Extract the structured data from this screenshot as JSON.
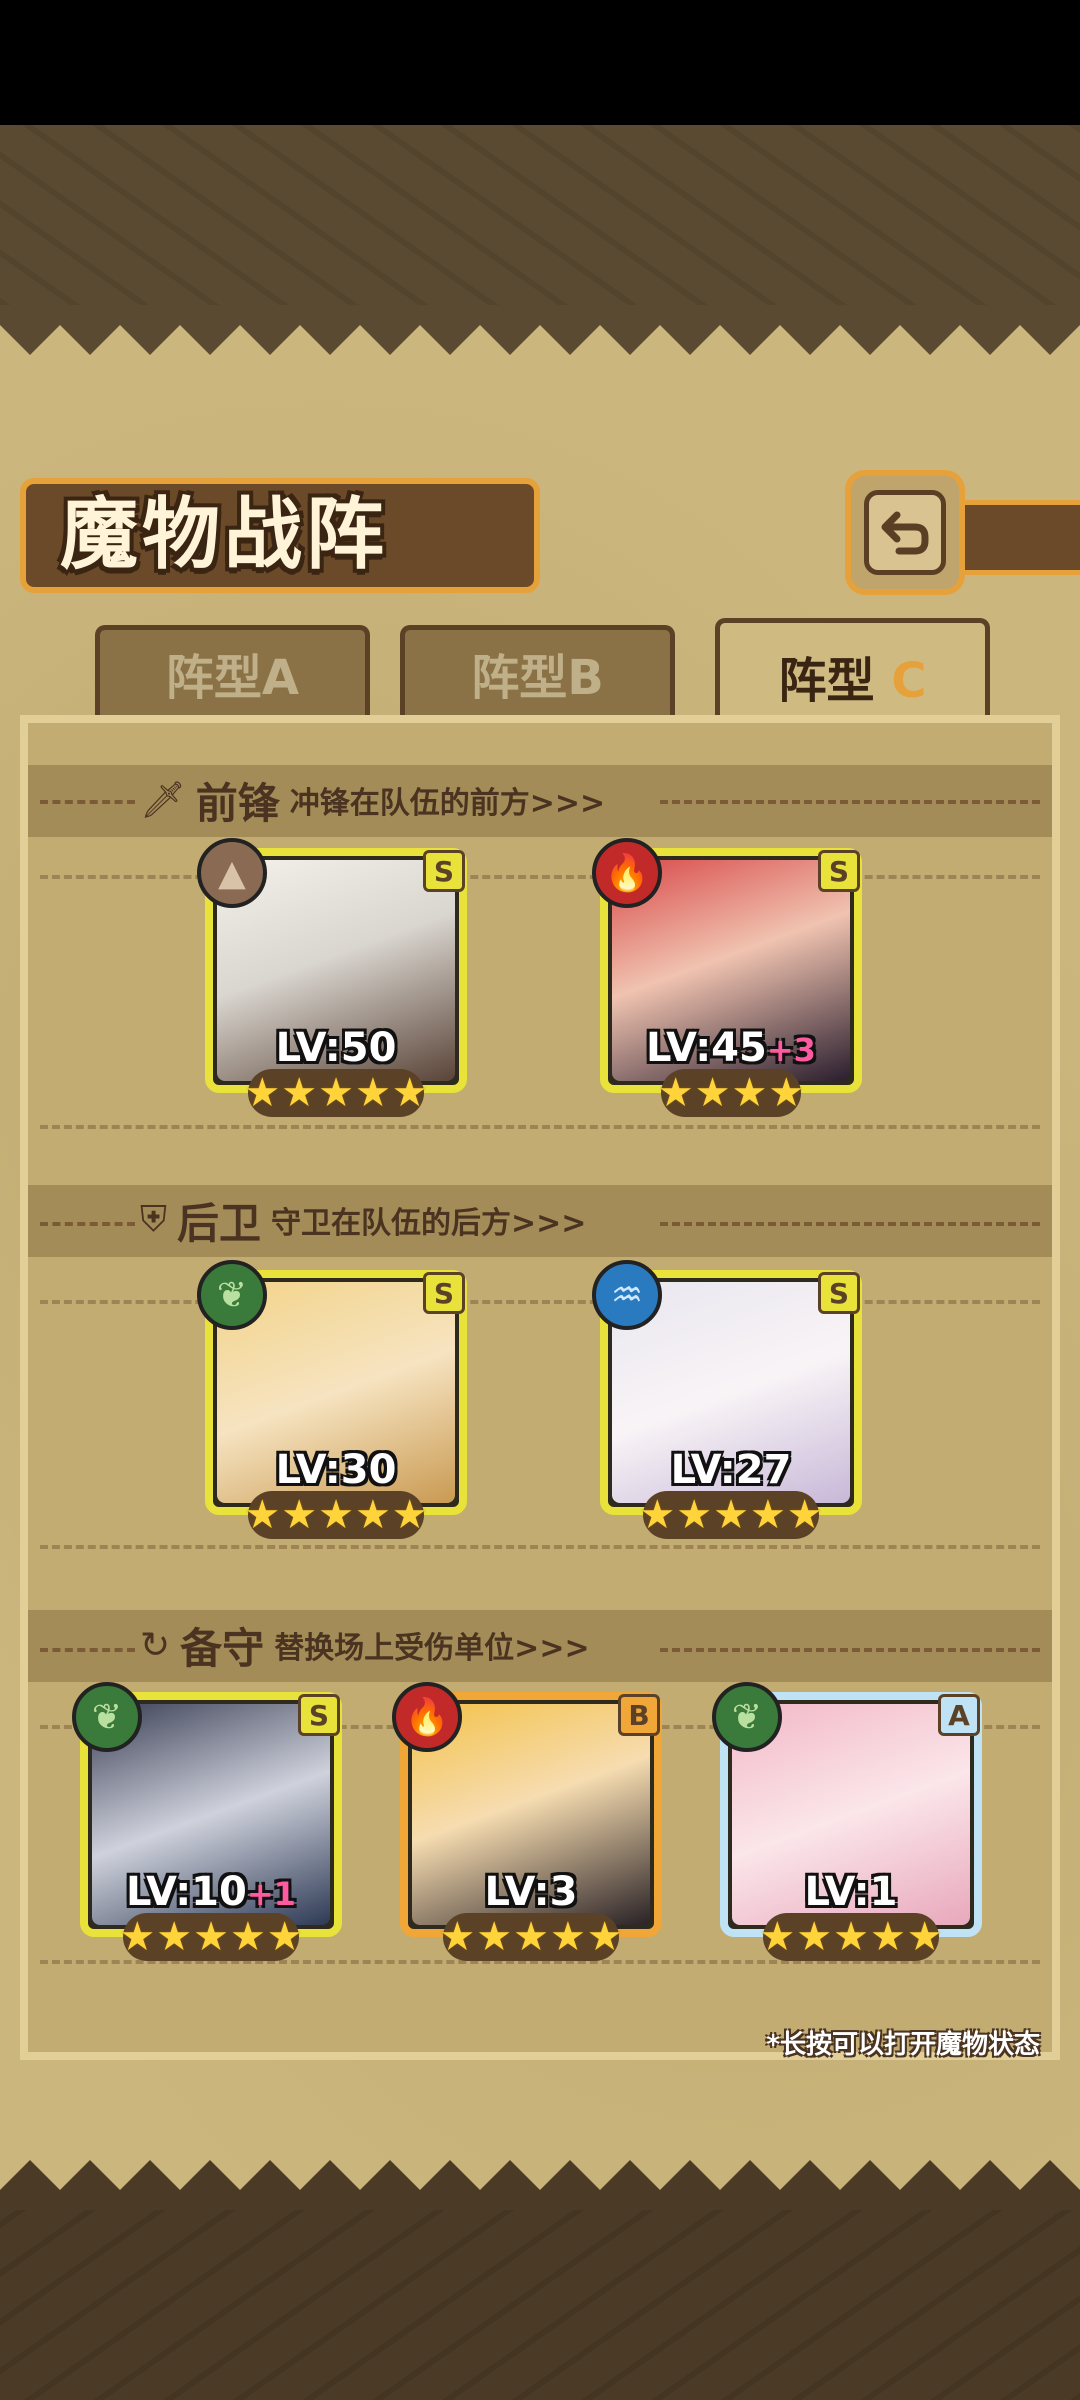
{
  "title": "魔物战阵",
  "tabs": [
    {
      "label_main": "阵型",
      "label_letter": "A",
      "active": false
    },
    {
      "label_main": "阵型",
      "label_letter": "B",
      "active": false
    },
    {
      "label_main": "阵型",
      "label_letter": "C",
      "active": true
    }
  ],
  "sections": {
    "front": {
      "title": "前锋",
      "desc": "冲锋在队伍的前方>>>",
      "icon": "sword-icon"
    },
    "rear": {
      "title": "后卫",
      "desc": "守卫在队伍的后方>>>",
      "icon": "shield-icon"
    },
    "reserve": {
      "title": "备守",
      "desc": "替换场上受伤单位>>>",
      "icon": "swap-icon"
    }
  },
  "units": [
    {
      "level": "LV:50",
      "bonus": "",
      "rank": "S",
      "element": "earth",
      "stars": 5,
      "section": "front"
    },
    {
      "level": "LV:45",
      "bonus": "+3",
      "rank": "S",
      "element": "fire",
      "stars": 4,
      "section": "front"
    },
    {
      "level": "LV:30",
      "bonus": "",
      "rank": "S",
      "element": "wood",
      "stars": 5,
      "section": "rear"
    },
    {
      "level": "LV:27",
      "bonus": "",
      "rank": "S",
      "element": "water",
      "stars": 5,
      "section": "rear"
    },
    {
      "level": "LV:10",
      "bonus": "+1",
      "rank": "S",
      "element": "wood",
      "stars": 5,
      "section": "reserve"
    },
    {
      "level": "LV:3",
      "bonus": "",
      "rank": "B",
      "element": "fire",
      "stars": 5,
      "section": "reserve"
    },
    {
      "level": "LV:1",
      "bonus": "",
      "rank": "A",
      "element": "wood",
      "stars": 5,
      "section": "reserve"
    }
  ],
  "hint": "*长按可以打开魔物状态",
  "colors": {
    "frame_yellow": "#e9e23a",
    "frame_orange": "#f1a638",
    "frame_blue": "#bfe3f5",
    "plate": "#6b4a2a",
    "accent": "#e6a13a"
  }
}
